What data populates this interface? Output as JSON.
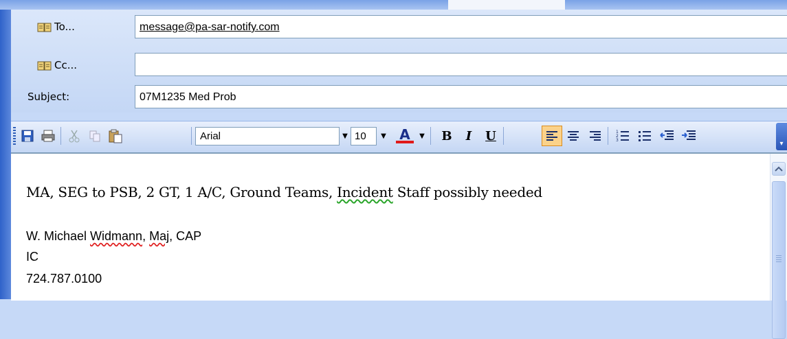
{
  "header": {
    "to_label": "To...",
    "cc_label": "Cc...",
    "subject_label": "Subject:",
    "to_value": "message@pa-sar-notify.com",
    "cc_value": "",
    "subject_value": "07M1235 Med Prob"
  },
  "toolbar": {
    "font_name": "Arial",
    "font_size": "10",
    "bold": "B",
    "italic": "I",
    "underline": "U",
    "font_color_glyph": "A",
    "font_color": "#e01a1a",
    "active_alignment": "align-left"
  },
  "body": {
    "line1_part1": "MA, SEG to PSB, 2 GT, 1 A/C, Ground Teams, ",
    "line1_word": "Incident",
    "line1_part2": " Staff possibly needed",
    "sig_name_part1": "W. Michael ",
    "sig_name_word1": "Widmann",
    "sig_name_part2": ", ",
    "sig_name_word2": "Maj",
    "sig_name_part3": ", CAP",
    "sig_role": "IC",
    "sig_phone": "724.787.0100"
  },
  "icons": [
    "grip-icon",
    "save-icon",
    "print-icon",
    "cut-icon",
    "copy-icon",
    "paste-icon",
    "font-color-icon",
    "align-left-icon",
    "align-center-icon",
    "align-right-icon",
    "numbered-list-icon",
    "bulleted-list-icon",
    "decrease-indent-icon",
    "increase-indent-icon",
    "toolbar-options-icon",
    "address-book-icon",
    "scroll-up-icon"
  ]
}
